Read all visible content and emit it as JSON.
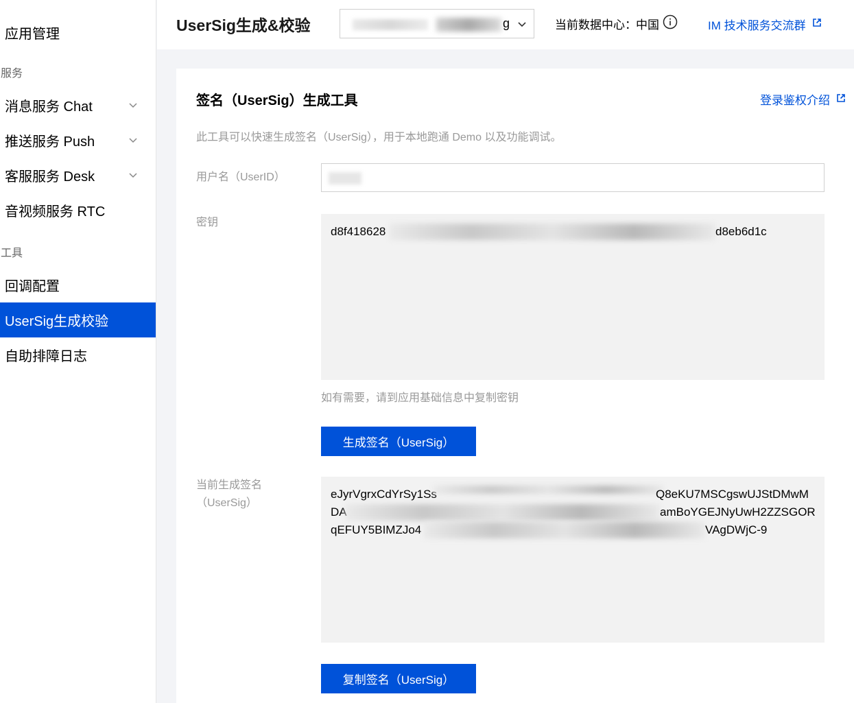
{
  "sidebar": {
    "title": "应用管理",
    "group_services": "服务",
    "group_tools": "工具",
    "items": [
      {
        "label": "消息服务 Chat"
      },
      {
        "label": "推送服务 Push"
      },
      {
        "label": "客服服务 Desk"
      },
      {
        "label": "音视频服务 RTC"
      },
      {
        "label": "回调配置"
      },
      {
        "label": "UserSig生成校验"
      },
      {
        "label": "自助排障日志"
      }
    ]
  },
  "header": {
    "title": "UserSig生成&校验",
    "app_select_value_tail": "g",
    "datacenter_label": "当前数据中心：",
    "datacenter_value": "中国",
    "support_link": "IM 技术服务交流群"
  },
  "card": {
    "title": "签名（UserSig）生成工具",
    "intro_link": "登录鉴权介绍",
    "description": "此工具可以快速生成签名（UserSig），用于本地跑通 Demo 以及功能调试。",
    "userid_label": "用户名（UserID）",
    "secret_label": "密钥",
    "secret_start": "d8f418628",
    "secret_end": "d8eb6d1c",
    "secret_hint": "如有需要，请到应用基础信息中复制密钥",
    "generate_button": "生成签名（UserSig）",
    "usersig_label_line1": "当前生成签名",
    "usersig_label_line2": "（UserSig）",
    "usersig_line1": "eJyrVgrxCdYrSy1Ss",
    "usersig_line1_end": "Q8eKU7MSCgswUJStDMwM",
    "usersig_line2_start": "DA",
    "usersig_line2_end": "amBoYGEJNyUwH2ZZSGOR",
    "usersig_line3_start": "qEFUY5BIMZJo4",
    "usersig_line3_end": "VAgDWjC-9",
    "copy_button": "复制签名（UserSig）"
  }
}
